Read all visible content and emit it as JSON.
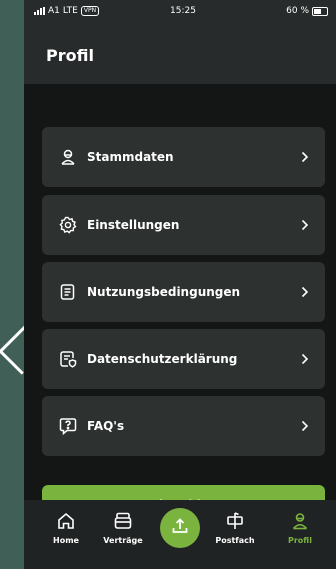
{
  "status_bar": {
    "carrier": "A1",
    "network": "LTE",
    "vpn": "VPN",
    "time": "15:25",
    "battery": "60 %"
  },
  "header": {
    "title": "Profil"
  },
  "menu": [
    {
      "label": "Stammdaten",
      "icon": "person-icon"
    },
    {
      "label": "Einstellungen",
      "icon": "gear-icon"
    },
    {
      "label": "Nutzungsbedingungen",
      "icon": "document-icon"
    },
    {
      "label": "Datenschutzerklärung",
      "icon": "privacy-document-icon"
    },
    {
      "label": "FAQ's",
      "icon": "question-bubble-icon"
    }
  ],
  "logout_label": "Abmelden",
  "tabbar": {
    "items": [
      {
        "label": "Home",
        "icon": "house-icon"
      },
      {
        "label": "Verträge",
        "icon": "contracts-icon"
      },
      {
        "label": "",
        "icon": "upload-icon"
      },
      {
        "label": "Postfach",
        "icon": "mailbox-icon"
      },
      {
        "label": "Profil",
        "icon": "person-icon",
        "active": true
      }
    ]
  },
  "colors": {
    "accent": "#7bb33f",
    "card": "#2d3130",
    "background": "#141515",
    "header": "#282b2b"
  }
}
